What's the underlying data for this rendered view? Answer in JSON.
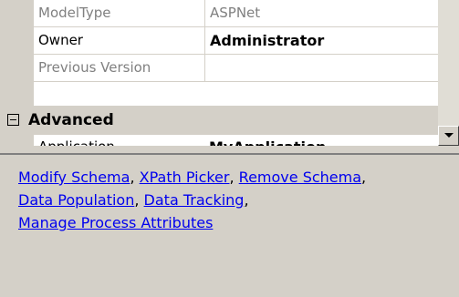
{
  "property_grid": {
    "rows": [
      {
        "name": "ModelType",
        "value": "ASPNet"
      },
      {
        "name": "Owner",
        "value": "Administrator"
      },
      {
        "name": "Previous Version",
        "value": ""
      }
    ],
    "category": {
      "label": "Advanced",
      "expander": "minus-expander-icon"
    },
    "partial_row": {
      "name": "Application",
      "value": "MyApplication"
    }
  },
  "scrollbar": {
    "down_arrow_icon": "chevron-down-icon"
  },
  "description_panel": {
    "links": [
      "Modify Schema",
      "XPath Picker",
      "Remove Schema",
      "Data Population",
      "Data Tracking",
      "Manage Process Attributes"
    ],
    "separator": ","
  },
  "colors": {
    "panel_bg": "#d4d0c8",
    "grid_bg": "#ffffff",
    "link": "#0000ee",
    "disabled_text": "#808080"
  }
}
